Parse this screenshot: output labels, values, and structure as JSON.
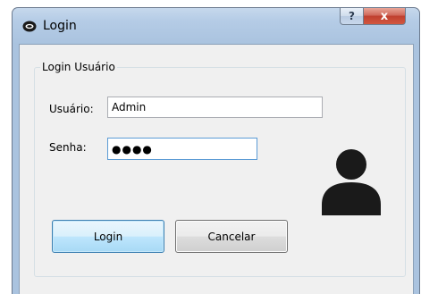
{
  "window": {
    "title": "Login",
    "help_glyph": "?",
    "close_glyph": "x"
  },
  "form": {
    "group_title": "Login Usuário",
    "username_label": "Usuário:",
    "username_value": "Admin",
    "password_label": "Senha:",
    "password_value": "●●●●",
    "login_button": "Login",
    "cancel_button": "Cancelar"
  },
  "icons": {
    "app": "app-logo-icon",
    "avatar": "user-avatar-icon"
  },
  "colors": {
    "title_bar": "#b5cce6",
    "close_button": "#c0402f",
    "client_bg": "#f0f0f0",
    "login_button_border": "#3c7fb1",
    "focus_border": "#5b9bd5",
    "avatar": "#1a1a1a"
  }
}
